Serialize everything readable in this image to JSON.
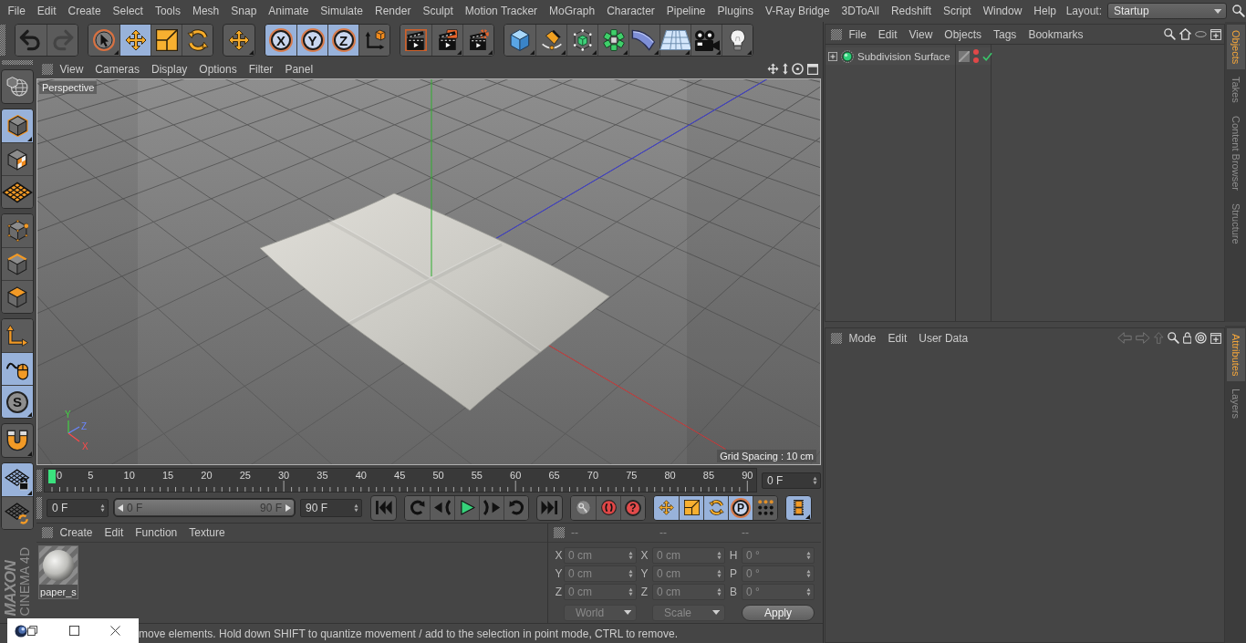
{
  "menu_bar": {
    "items": [
      "File",
      "Edit",
      "Create",
      "Select",
      "Tools",
      "Mesh",
      "Snap",
      "Animate",
      "Simulate",
      "Render",
      "Sculpt",
      "Motion Tracker",
      "MoGraph",
      "Character",
      "Pipeline",
      "Plugins",
      "V-Ray Bridge",
      "3DToAll",
      "Redshift",
      "Script",
      "Window",
      "Help"
    ],
    "layout_label": "Layout:",
    "layout_value": "Startup"
  },
  "toolbar": {
    "groups": [
      [
        {
          "kind": "undo",
          "on": false,
          "disabled": false
        },
        {
          "kind": "redo",
          "on": false,
          "disabled": true
        }
      ],
      [
        {
          "kind": "select",
          "on": false,
          "disabled": false
        },
        {
          "kind": "move",
          "on": true,
          "disabled": false
        },
        {
          "kind": "scale",
          "on": false,
          "disabled": false
        },
        {
          "kind": "rotate",
          "on": false,
          "disabled": false
        }
      ],
      [
        {
          "kind": "recent",
          "on": false,
          "disabled": false
        }
      ],
      [
        {
          "kind": "lock",
          "label": "X",
          "on": true,
          "disabled": false
        },
        {
          "kind": "lock",
          "label": "Y",
          "on": true,
          "disabled": false
        },
        {
          "kind": "lock",
          "label": "Z",
          "on": true,
          "disabled": false
        },
        {
          "kind": "coords",
          "on": false,
          "disabled": false
        }
      ],
      [
        {
          "kind": "renderview",
          "on": false,
          "disabled": false
        },
        {
          "kind": "renderpicture",
          "on": false,
          "disabled": false
        },
        {
          "kind": "rendersettings",
          "on": false,
          "disabled": false
        }
      ],
      [
        {
          "kind": "cube",
          "on": false,
          "disabled": false
        },
        {
          "kind": "pen",
          "on": false,
          "disabled": false
        },
        {
          "kind": "subdivision",
          "on": false,
          "disabled": false
        },
        {
          "kind": "cloner",
          "on": false,
          "disabled": false
        },
        {
          "kind": "bend",
          "on": false,
          "disabled": false
        },
        {
          "kind": "floor",
          "on": false,
          "disabled": false
        },
        {
          "kind": "camera",
          "on": false,
          "disabled": false
        },
        {
          "kind": "light",
          "on": false,
          "disabled": false
        }
      ]
    ]
  },
  "left_toolbar": {
    "groups": [
      [
        {
          "kind": "editable",
          "on": false
        }
      ],
      [
        {
          "kind": "model",
          "on": true
        },
        {
          "kind": "texture",
          "on": false
        },
        {
          "kind": "workplane",
          "on": false
        }
      ],
      [
        {
          "kind": "points",
          "on": false
        },
        {
          "kind": "edges",
          "on": false
        },
        {
          "kind": "polygons",
          "on": false
        }
      ],
      [
        {
          "kind": "axis",
          "on": false
        },
        {
          "kind": "tweak",
          "on": true
        },
        {
          "kind": "snap",
          "label": "S",
          "on": true
        }
      ],
      [
        {
          "kind": "magnet",
          "on": false
        }
      ],
      [
        {
          "kind": "gridlock",
          "on": true
        },
        {
          "kind": "gridsync",
          "on": false
        }
      ]
    ],
    "logo": {
      "brand": "MAXON",
      "product": "CINEMA 4D"
    }
  },
  "viewport": {
    "menu": [
      "View",
      "Cameras",
      "Display",
      "Options",
      "Filter",
      "Panel"
    ],
    "camera_label": "Perspective",
    "grid_spacing": "Grid Spacing : 10 cm",
    "gizmo_labels": [
      "Y",
      "Z",
      "X"
    ]
  },
  "timeline": {
    "ticks": [
      "0",
      "5",
      "10",
      "15",
      "20",
      "25",
      "30",
      "35",
      "40",
      "45",
      "50",
      "55",
      "60",
      "65",
      "70",
      "75",
      "80",
      "85",
      "90"
    ],
    "playhead": {
      "level": 0
    },
    "current_frame": "0 F"
  },
  "transport": {
    "start_field": "0 F",
    "range": {
      "from": "0 F",
      "to": "90 F",
      "level": 1
    },
    "end_field": "90 F",
    "groups": [
      [
        {
          "kind": "first",
          "on": false
        }
      ],
      [
        {
          "kind": "prevkey",
          "on": false
        },
        {
          "kind": "prevframe",
          "on": false
        },
        {
          "kind": "play",
          "on": false
        },
        {
          "kind": "nextframe",
          "on": false
        },
        {
          "kind": "nextkey",
          "on": false
        }
      ],
      [
        {
          "kind": "last",
          "on": false
        }
      ],
      [
        {
          "kind": "record",
          "on": false
        },
        {
          "kind": "autokey",
          "on": false
        },
        {
          "kind": "keyhelp",
          "label": "?",
          "on": false
        }
      ],
      [
        {
          "kind": "keymove",
          "on": true
        },
        {
          "kind": "keyscale",
          "on": true
        },
        {
          "kind": "keyrotate",
          "on": true
        },
        {
          "kind": "param",
          "label": "P",
          "on": true
        },
        {
          "kind": "pla",
          "on": false
        }
      ],
      [
        {
          "kind": "film",
          "on": true
        }
      ]
    ]
  },
  "material_manager": {
    "menu": [
      "Create",
      "Edit",
      "Function",
      "Texture"
    ],
    "materials": [
      {
        "name": "paper_s"
      }
    ]
  },
  "coordinates": {
    "headers": [
      "--",
      "--",
      "--"
    ],
    "columns": [
      [
        {
          "label": "X",
          "value": "0 cm",
          "disabled": true
        },
        {
          "label": "Y",
          "value": "0 cm",
          "disabled": true
        },
        {
          "label": "Z",
          "value": "0 cm",
          "disabled": true
        }
      ],
      [
        {
          "label": "X",
          "value": "0 cm",
          "disabled": true
        },
        {
          "label": "Y",
          "value": "0 cm",
          "disabled": true
        },
        {
          "label": "Z",
          "value": "0 cm",
          "disabled": true
        }
      ],
      [
        {
          "label": "H",
          "value": "0 °",
          "disabled": true
        },
        {
          "label": "P",
          "value": "0 °",
          "disabled": true
        },
        {
          "label": "B",
          "value": "0 °",
          "disabled": true
        }
      ]
    ],
    "dropdowns": [
      {
        "value": "World",
        "disabled": true
      },
      {
        "value": "Scale",
        "disabled": true
      }
    ],
    "apply_button": "Apply"
  },
  "status_bar": {
    "text": "move elements. Hold down SHIFT to quantize movement / add to the selection in point mode, CTRL to remove."
  },
  "object_manager": {
    "menu": [
      "File",
      "Edit",
      "View",
      "Objects",
      "Tags",
      "Bookmarks"
    ],
    "objects": [
      {
        "name": "Subdivision Surface",
        "expanded": false,
        "editor_visible": false,
        "render_visible": false,
        "enabled": true
      }
    ],
    "tabs": [
      {
        "label": "Objects",
        "selected": true
      },
      {
        "label": "Takes",
        "selected": false
      },
      {
        "label": "Content Browser",
        "selected": false
      },
      {
        "label": "Structure",
        "selected": false
      }
    ]
  },
  "attributes": {
    "menu": [
      "Mode",
      "Edit",
      "User Data"
    ],
    "nav_buttons": [
      {
        "kind": "back",
        "disabled": true
      },
      {
        "kind": "forward",
        "disabled": true
      },
      {
        "kind": "up",
        "disabled": true
      }
    ],
    "tabs": [
      {
        "label": "Attributes",
        "selected": true
      },
      {
        "label": "Layers",
        "selected": false
      }
    ]
  }
}
